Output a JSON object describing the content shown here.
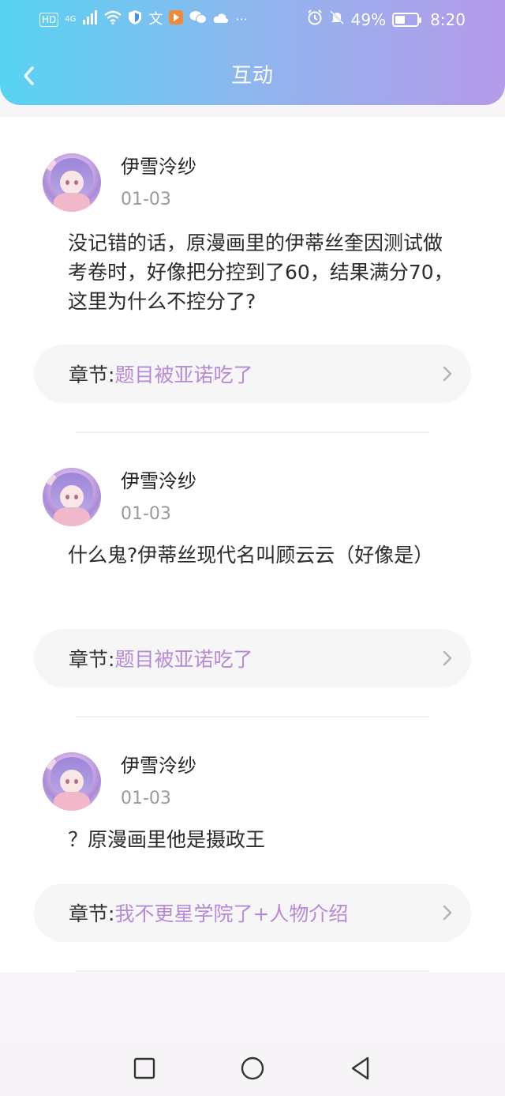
{
  "status_bar": {
    "left_icons": [
      "HD",
      "4G",
      "signal-icon",
      "wifi-icon",
      "shield-icon",
      "translate-icon",
      "app-icon",
      "wechat-icon",
      "cloud-icon",
      "···"
    ],
    "battery_percent": "49%",
    "time": "8:20"
  },
  "header": {
    "title": "互动",
    "gradient": [
      "#57d3f2",
      "#b59ae9"
    ]
  },
  "comments": [
    {
      "username": "伊雪泠纱",
      "date": "01-03",
      "text": "没记错的话，原漫画里的伊蒂丝奎因测试做考卷时，好像把分控到了60，结果满分70，这里为什么不控分了?",
      "chapter_prefix": "章节:",
      "chapter_title": "题目被亚诺吃了"
    },
    {
      "username": "伊雪泠纱",
      "date": "01-03",
      "text": "什么鬼?伊蒂丝现代名叫顾云云（好像是）",
      "chapter_prefix": "章节:",
      "chapter_title": "题目被亚诺吃了"
    },
    {
      "username": "伊雪泠纱",
      "date": "01-03",
      "text": "？原漫画里他是摄政王",
      "chapter_prefix": "章节:",
      "chapter_title": "我不更星学院了+人物介绍"
    }
  ],
  "colors": {
    "chapter_title": "#b68ad7",
    "date": "#9a9a9a"
  },
  "nav": {
    "buttons": [
      "square-icon",
      "circle-icon",
      "triangle-back-icon"
    ]
  }
}
